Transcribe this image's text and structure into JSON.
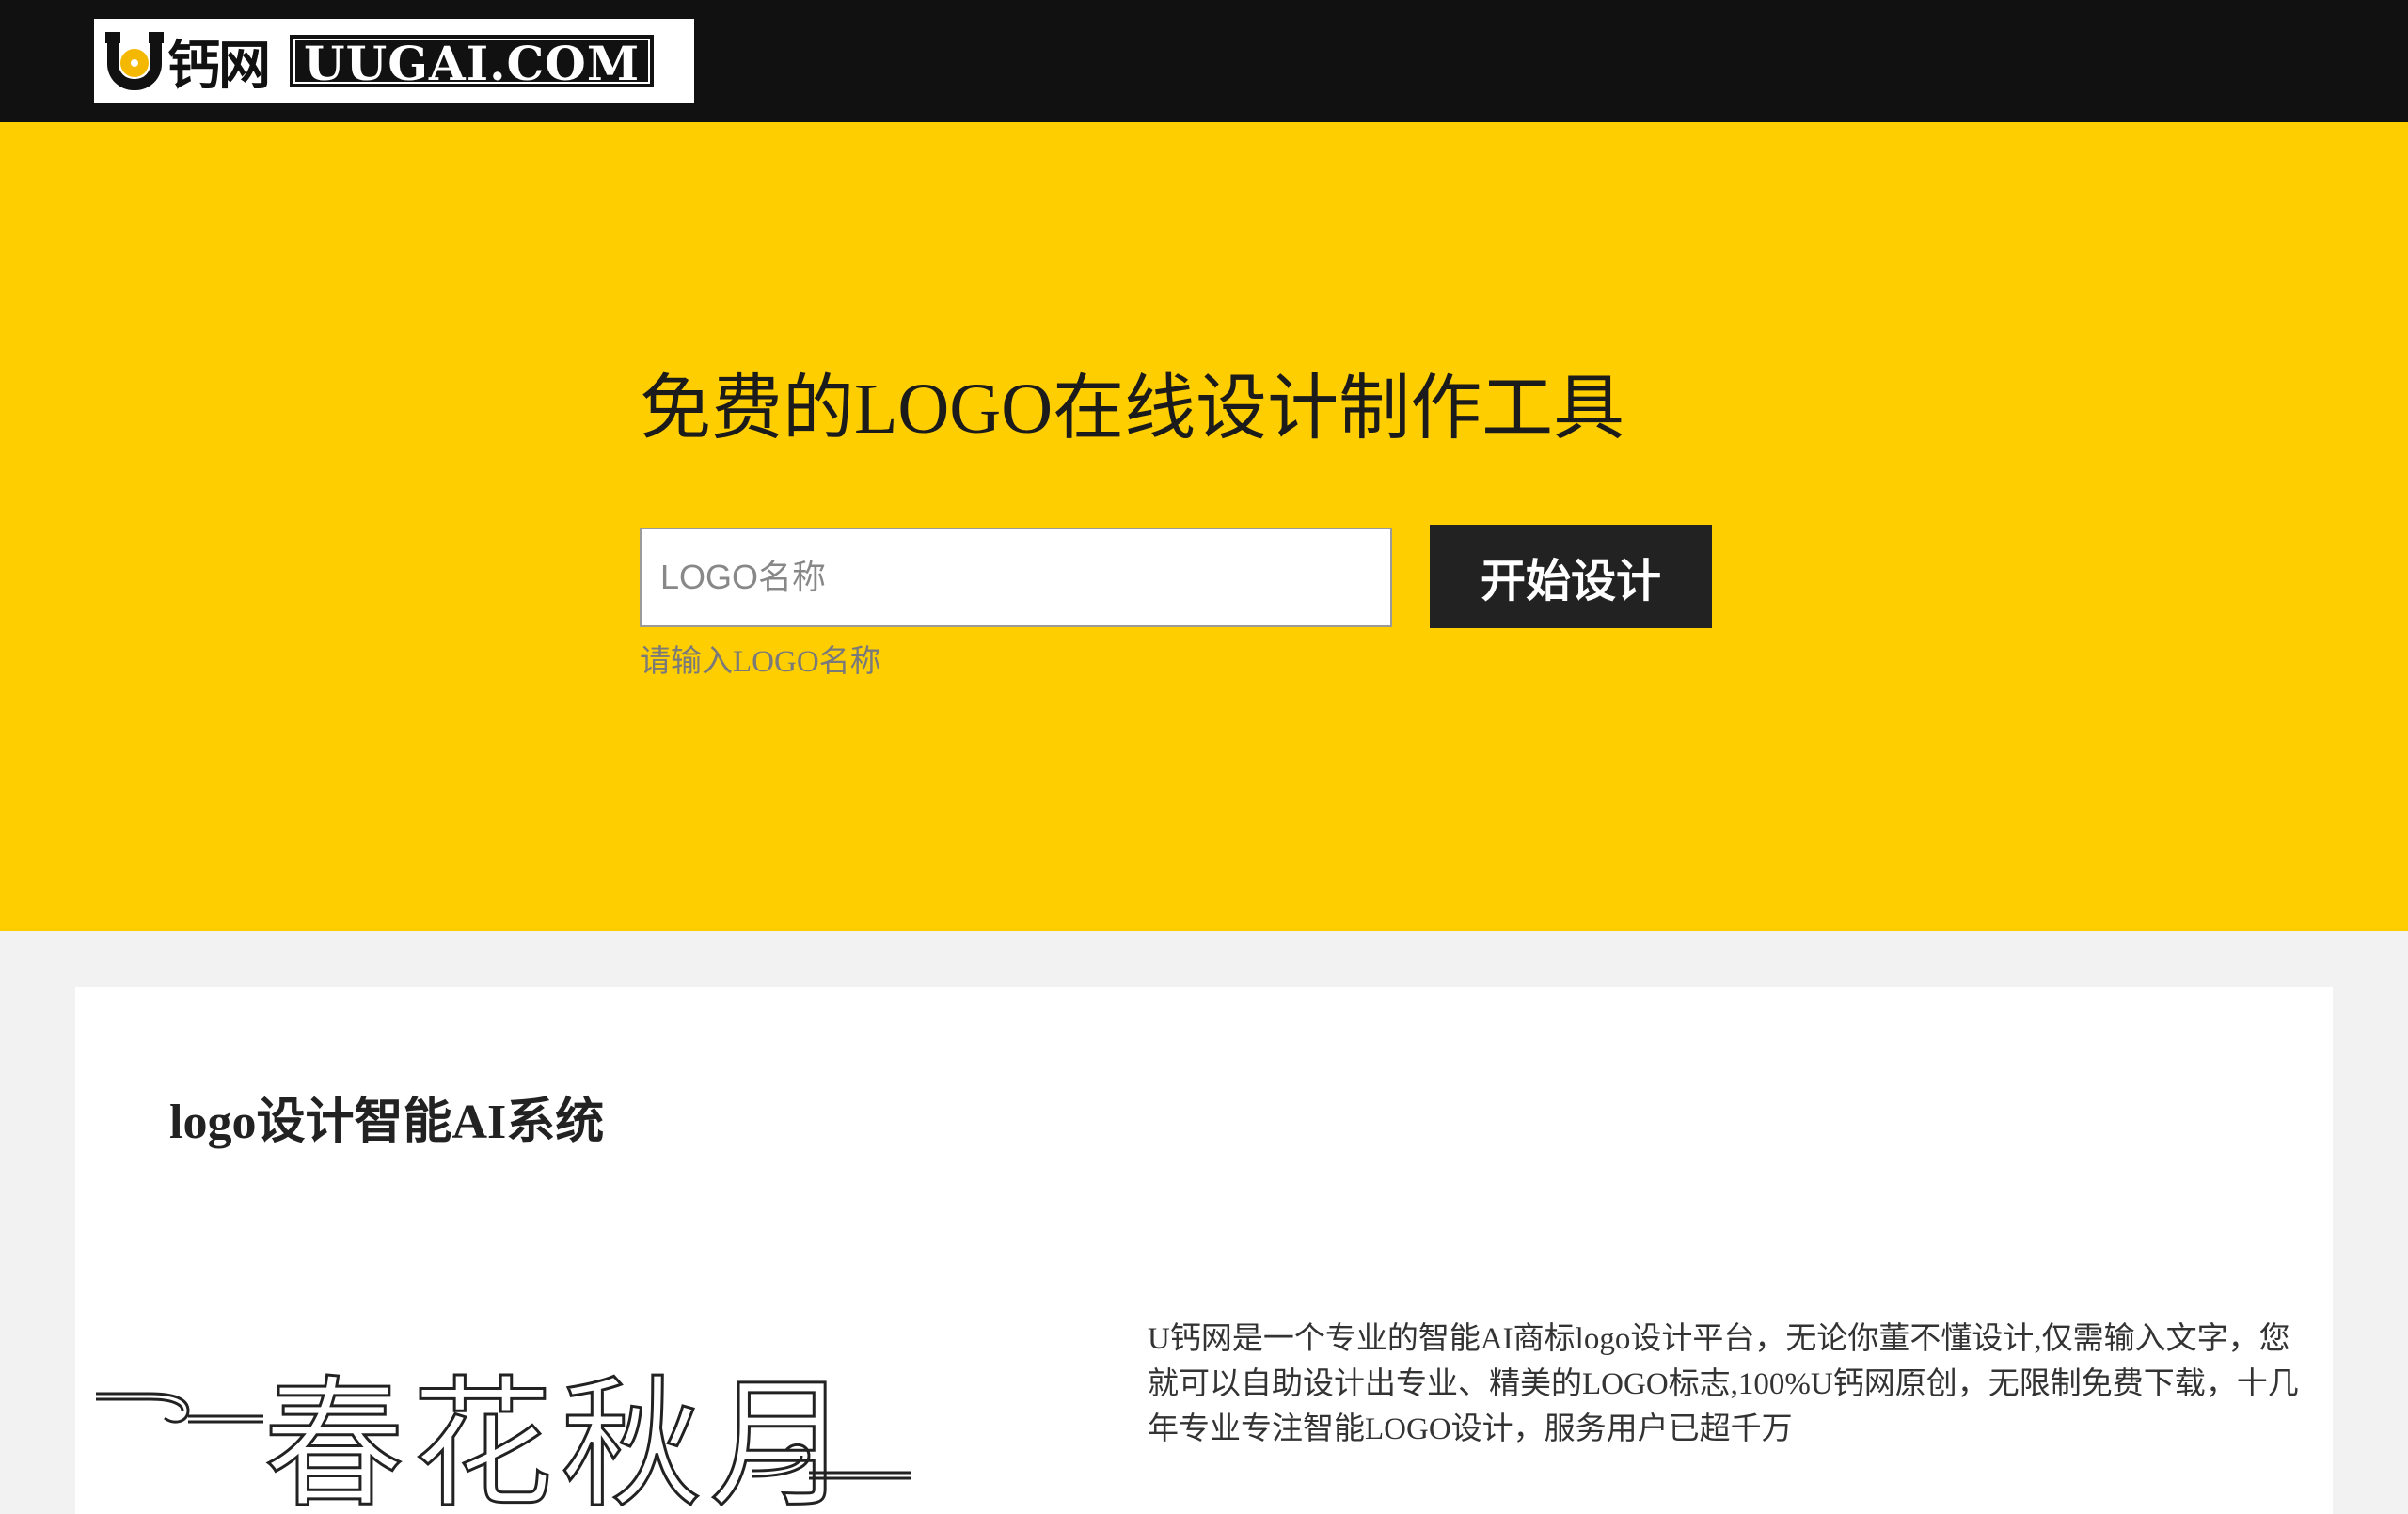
{
  "header": {
    "brand_cn": "钙网",
    "brand_domain": "UUGAI.COM"
  },
  "hero": {
    "title": "免费的LOGO在线设计制作工具",
    "input_placeholder": "LOGO名称",
    "input_value": "",
    "button_label": "开始设计",
    "hint": "请输入LOGO名称"
  },
  "section": {
    "title": "logo设计智能AI系统",
    "art_text": "春花秋月",
    "description": "U钙网是一个专业的智能AI商标logo设计平台，无论你董不懂设计,仅需输入文字，您就可以自助设计出专业、精美的LOGO标志,100%U钙网原创，无限制免费下载，十几年专业专注智能LOGO设计，服务用户已超千万"
  },
  "colors": {
    "topbar": "#111111",
    "hero_bg": "#ffce00",
    "button_bg": "#222222",
    "page_bg": "#f2f2f3"
  }
}
